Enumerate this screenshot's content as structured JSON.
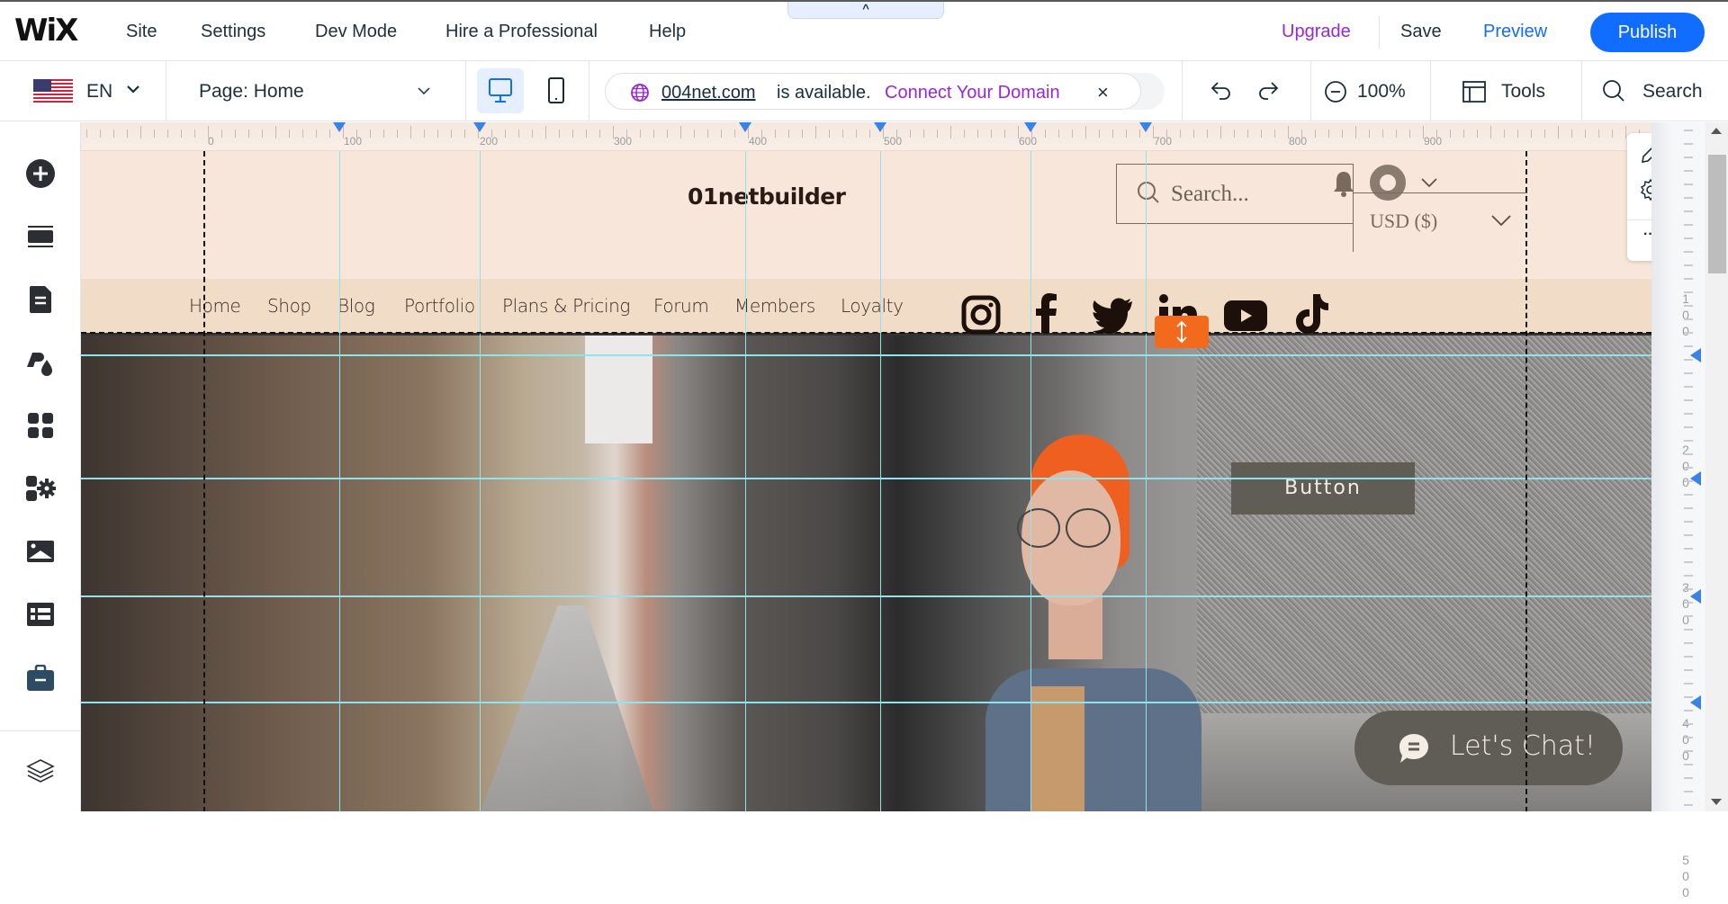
{
  "topbar": {
    "logo": "WiX",
    "menu": [
      {
        "label": "Site"
      },
      {
        "label": "Settings"
      },
      {
        "label": "Dev Mode"
      },
      {
        "label": "Hire a Professional"
      },
      {
        "label": "Help"
      }
    ],
    "collapse_glyph": "^",
    "upgrade_label": "Upgrade",
    "save_label": "Save",
    "preview_label": "Preview",
    "publish_label": "Publish",
    "colors": {
      "accent": "#116dff",
      "upgrade": "#9a27d5"
    }
  },
  "secondbar": {
    "language": "EN",
    "page_select": "Page: Home",
    "devices": [
      "desktop",
      "mobile"
    ],
    "active_device": "desktop",
    "domain_banner": {
      "domain": "004net.com",
      "availability": "is available.",
      "connect_label": "Connect Your Domain",
      "close_glyph": "×"
    },
    "zoom_level": "100%",
    "tools_label": "Tools",
    "search_label": "Search"
  },
  "sidebar": {
    "items": [
      {
        "name": "add-elements",
        "icon": "plus-circle-icon"
      },
      {
        "name": "add-section",
        "icon": "section-strip-icon"
      },
      {
        "name": "pages-menu",
        "icon": "page-icon"
      },
      {
        "name": "site-design",
        "icon": "theme-icon"
      },
      {
        "name": "add-apps",
        "icon": "apps-grid-icon"
      },
      {
        "name": "app-settings",
        "icon": "apps-gear-icon"
      },
      {
        "name": "media",
        "icon": "image-icon"
      },
      {
        "name": "cms",
        "icon": "table-icon"
      },
      {
        "name": "business-tools",
        "icon": "briefcase-icon"
      }
    ],
    "bottom_item": {
      "name": "layers",
      "icon": "layers-icon"
    }
  },
  "canvas": {
    "ruler_top_labels": [
      "0",
      "100",
      "200",
      "300",
      "400",
      "500",
      "600",
      "700",
      "800",
      "900"
    ],
    "ruler_right_labels": [
      "100",
      "200",
      "300",
      "400",
      "500"
    ],
    "site": {
      "title": "01netbuilder",
      "nav": [
        "Home",
        "Shop",
        "Blog",
        "Portfolio",
        "Plans & Pricing",
        "Forum",
        "Members",
        "Loyalty"
      ],
      "search_placeholder": "Search...",
      "currency": "USD ($)",
      "social": [
        "instagram",
        "facebook",
        "twitter",
        "linkedin",
        "youtube",
        "tiktok"
      ],
      "cta_button": "Button",
      "chat_label": "Let's Chat!"
    },
    "colors": {
      "header_bg": "#f7e6d9",
      "nav_bg": "#f1dcc8",
      "button_bg": "#5f5d55",
      "handle": "#f26b1d",
      "guides": "#8ee3ee"
    }
  },
  "floating_panel": {
    "items": [
      {
        "icon": "pencil-icon"
      },
      {
        "icon": "gear-icon"
      },
      {
        "icon": "more-icon"
      }
    ],
    "more_glyph": "···"
  }
}
